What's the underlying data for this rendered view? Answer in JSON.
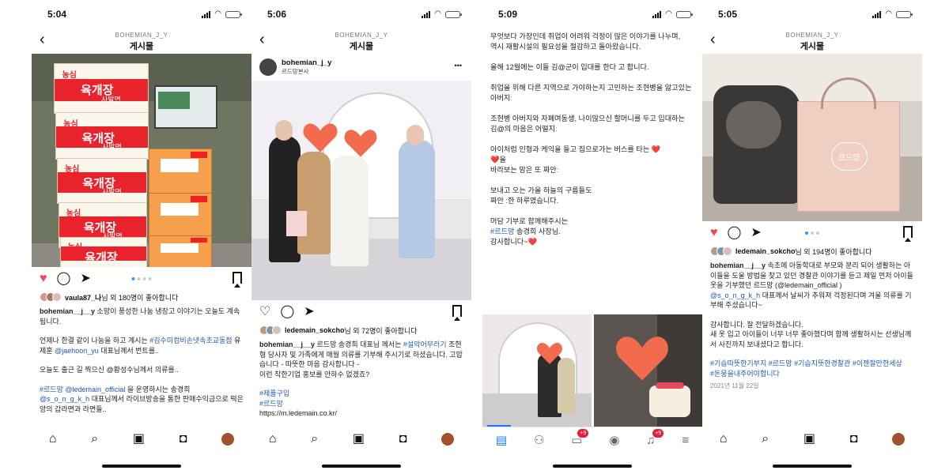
{
  "panel1": {
    "time": "5:04",
    "header_user": "BOHEMIAN_J_Y",
    "header_title": "게시물",
    "likes_user": "vaula87_나",
    "likes_text": "님 외 180명이 좋아합니다",
    "caption_user": "bohemian__j__y",
    "caption_1": "소망이 풍성한 나눔 냉장고 이야기는 오늘도 계속됩니다.",
    "caption_2a": "언제나 한결 같이 나눔을 하고 계시는 ",
    "caption_2_tag1": "#김수미컴비손냇속초교동점",
    "caption_2b": " 유제훈 ",
    "caption_2_mention": "@jaehoon_yu",
    "caption_2c": " 대표님께서 번트를..",
    "caption_3": "오늘도 출근 길 찍으신 @황성수님께서 의류를..",
    "caption_4_tag": "#르드망",
    "caption_4_mention": "@ledemain_official",
    "caption_4a": " 을 운영하시는 송경희",
    "caption_4_mention2": "@s_o_n_g_k_h",
    "caption_4b": " 대표님께서 라이브방송을 통한 판매수익금으로 떡은앙의 갑라면과 라면들.."
  },
  "panel2": {
    "time": "5:06",
    "header_user": "BOHEMIAN_J_Y",
    "header_title": "게시물",
    "post_user": "bohemian_j_y",
    "post_location": "르드망본사",
    "more": "•••",
    "likes_user": "ledemain_sokcho",
    "likes_text": "님 외 72명이 좋아합니다",
    "caption_user": "bohemian__j__y",
    "caption_a": " 르드망 송경희 대표님 께서는 ",
    "caption_tag1": "#설악어무러기",
    "caption_b": " 조현형 당사자 및 가족에게 매월 의류를 기부해 주시기로 하셨습니다. 고맙습니다 - 따뜻한 마음 감사합니다 -",
    "caption_c": "이런 착한기업 홍보를 안하수 없겠죠?",
    "tag_1": "#제품구입",
    "tag_2": "#르드망",
    "link": "https://m.ledemain.co.kr/"
  },
  "panel3": {
    "time": "5:09",
    "p1": "무엇보다 가장인데 취업이 어려워 걱정이 많은 이야기를 나누며,",
    "p1b": "역시 재활시설의 필요성을 절감하고 돌아왔습니다.",
    "p2": "올해 12월에는 이들 김@군이 입대를 한다 고 합니다.",
    "p3": "취업을 위해 다른 지역으로 가야하는지 고민하는 조현병을 앓고있는 아버지ː",
    "p4": "조현병 아버지와 자폐여동생, 나이많으신 할머니를 두고 입대하는",
    "p4b": "김@의 마음은 어떨지ː",
    "p5": "아이처럼 인형과 케익을 들고 집으로가는 버스를 타는 ❤️",
    "p5b": "❤️을",
    "p5c": "바라보는 맘은 또 짜안ː",
    "p6": "보내고 오는 가을 하늘의 구름들도",
    "p6b": "짜안 :한 하루였습니다.",
    "p7": "머담 기부로 함께해주시는",
    "p7_tag": "#르드망",
    "p7b": " 송경희 사장님.",
    "p8": "감사합니다~❤️",
    "badge1": "+9",
    "badge2": "+9"
  },
  "panel4": {
    "time": "5:05",
    "header_user": "BOHEMIAN_J_Y",
    "header_title": "게시물",
    "likes_user": "ledemain_sokcho",
    "likes_text": "님 외 194명이 좋아합니다",
    "caption_user": "bohemian__j__y",
    "caption_a": " 속초에 아동학대로 부모와 분리 되어 생활하는 아이들을 도울 방법을 찾고 있던 경찰관 이야기를 듣고 제일 먼저 아이들 옷을 기부했던 르드망 ",
    "caption_mention1": "(@ledemain_official )",
    "caption_mention2": "@s_o_n_g_k_h",
    "caption_b": " 대표께서 날씨가 추워져 걱정된다며 겨울 의류를 기부해 주셨습니다~",
    "caption_c": "감사합니다. 잘 전달하겠습니다.",
    "caption_d": "새 옷 입고 아이들이 너무 너무 좋아했다며 함께 생활하시는 선생님께서 사진까지 보내셨다고 합니다.",
    "tags": "#기습따뜻한기부지 #르드망 #기습지뜻한경찰관 #이젠잘만한세상",
    "tags2": "#돈뭉을내주어야합니다",
    "date": "2021년 11월 22일",
    "bag_logo": "르드망"
  }
}
